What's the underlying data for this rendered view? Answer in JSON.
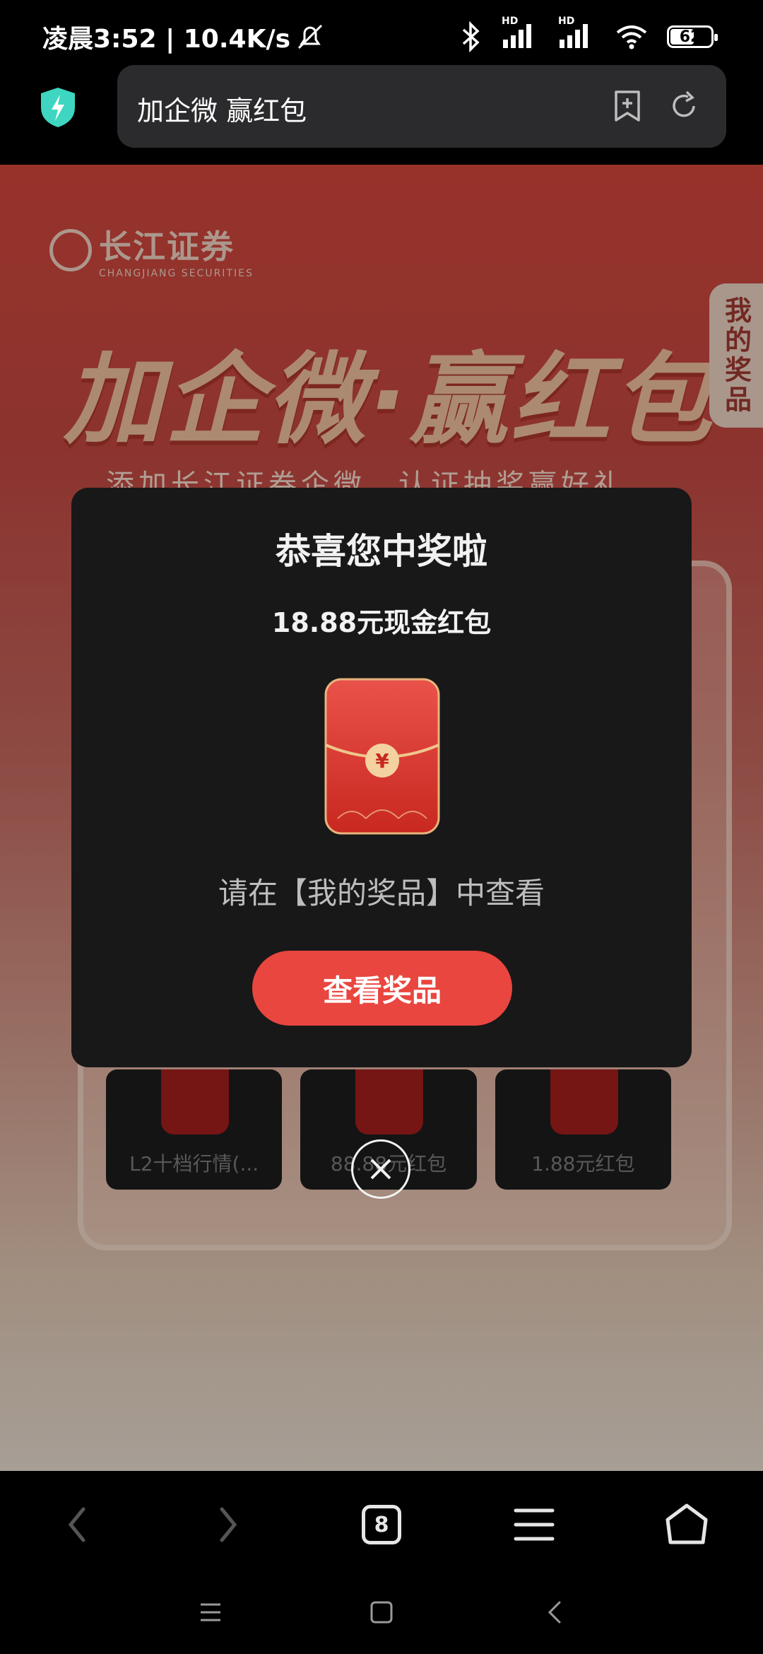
{
  "status_bar": {
    "time_speed": "凌晨3:52 | 10.4K/s",
    "battery_level": "62",
    "battery_fraction": 0.62,
    "signal1_label": "HD",
    "signal2_label": "HD"
  },
  "browser": {
    "url_title": "加企微 赢红包",
    "shield_color": "#3ed6c0"
  },
  "page": {
    "brand_name": "长江证券",
    "brand_sub": "CHANGJIANG SECURITIES",
    "hero_title": "加企微·赢红包",
    "hero_subtitle": "添加长江证券企微，认证抽奖赢好礼",
    "side_tab": "我的奖品",
    "prizes": [
      {
        "label": "L2十档行情(..."
      },
      {
        "label": "88.88元红包"
      },
      {
        "label": "1.88元红包"
      }
    ]
  },
  "modal": {
    "title": "恭喜您中奖啦",
    "amount": "18.88元现金红包",
    "envelope_symbol": "¥",
    "hint": "请在【我的奖品】中查看",
    "button": "查看奖品",
    "accent_color": "#e9463f"
  },
  "bottom_nav": {
    "tab_count": "8"
  }
}
